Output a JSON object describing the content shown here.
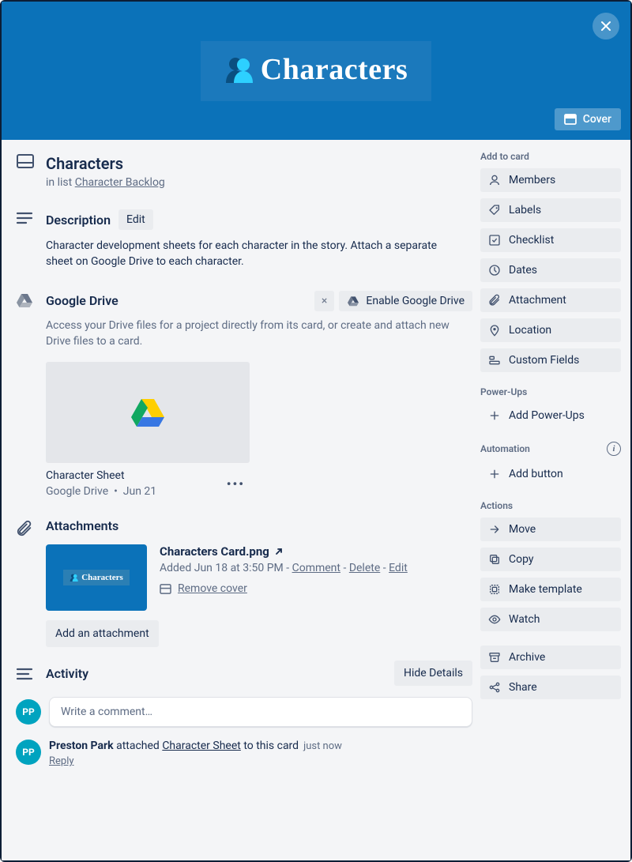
{
  "cover": {
    "title": "Characters",
    "button": "Cover"
  },
  "card": {
    "title": "Characters",
    "in_list_prefix": "in list ",
    "list_name": "Character Backlog"
  },
  "description": {
    "heading": "Description",
    "edit": "Edit",
    "text": "Character development sheets for each character in the story. Attach a separate sheet on Google Drive to each character."
  },
  "drive": {
    "heading": "Google Drive",
    "enable": "Enable Google Drive",
    "subtext": "Access your Drive files for a project directly from its card, or create and attach new Drive files to a card.",
    "file_name": "Character Sheet",
    "file_meta_source": "Google Drive",
    "file_meta_date": "Jun 21",
    "close_x": "×"
  },
  "attachments": {
    "heading": "Attachments",
    "file_title": "Characters Card.png",
    "added_prefix": "Added Jun 18 at 3:50 PM",
    "comment": "Comment",
    "delete": "Delete",
    "edit": "Edit",
    "remove_cover": "Remove cover",
    "add_button": "Add an attachment",
    "thumb_text": "Characters"
  },
  "activity": {
    "heading": "Activity",
    "hide": "Hide Details",
    "comment_placeholder": "Write a comment…",
    "avatar_initials": "PP",
    "entry_user": "Preston Park",
    "entry_action_prefix": " attached ",
    "entry_link": "Character Sheet",
    "entry_action_suffix": " to this card",
    "entry_time": "just now",
    "reply": "Reply"
  },
  "sidebar": {
    "add_heading": "Add to card",
    "add_items": [
      "Members",
      "Labels",
      "Checklist",
      "Dates",
      "Attachment",
      "Location",
      "Custom Fields"
    ],
    "powerups_heading": "Power-Ups",
    "powerups_add": "Add Power-Ups",
    "automation_heading": "Automation",
    "automation_add": "Add button",
    "actions_heading": "Actions",
    "actions_items": [
      "Move",
      "Copy",
      "Make template",
      "Watch",
      "Archive",
      "Share"
    ]
  }
}
